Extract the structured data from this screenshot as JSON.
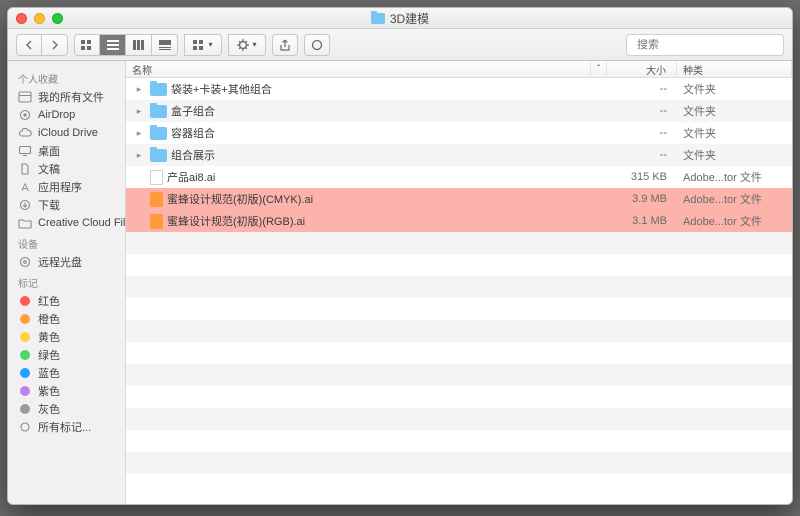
{
  "window": {
    "title": "3D建模"
  },
  "search": {
    "placeholder": "搜索"
  },
  "sidebar": {
    "sections": [
      {
        "header": "个人收藏",
        "items": [
          {
            "icon": "all-files",
            "label": "我的所有文件"
          },
          {
            "icon": "airdrop",
            "label": "AirDrop"
          },
          {
            "icon": "icloud",
            "label": "iCloud Drive"
          },
          {
            "icon": "desktop",
            "label": "桌面"
          },
          {
            "icon": "documents",
            "label": "文稿"
          },
          {
            "icon": "apps",
            "label": "应用程序"
          },
          {
            "icon": "downloads",
            "label": "下载"
          },
          {
            "icon": "folder",
            "label": "Creative Cloud Files"
          }
        ]
      },
      {
        "header": "设备",
        "items": [
          {
            "icon": "disc",
            "label": "远程光盘"
          }
        ]
      },
      {
        "header": "标记",
        "items": [
          {
            "color": "#ff5b56",
            "label": "红色"
          },
          {
            "color": "#ff9f3c",
            "label": "橙色"
          },
          {
            "color": "#ffd23c",
            "label": "黄色"
          },
          {
            "color": "#4cd964",
            "label": "绿色"
          },
          {
            "color": "#1ea1ff",
            "label": "蓝色"
          },
          {
            "color": "#c17fe8",
            "label": "紫色"
          },
          {
            "color": "#9b9b9b",
            "label": "灰色"
          },
          {
            "icon": "all-tags",
            "label": "所有标记..."
          }
        ]
      }
    ]
  },
  "columns": {
    "name": "名称",
    "size": "大小",
    "kind": "种类"
  },
  "rows": [
    {
      "type": "folder",
      "expandable": true,
      "name": "袋装+卡装+其他组合",
      "size": "--",
      "kind": "文件夹"
    },
    {
      "type": "folder",
      "expandable": true,
      "name": "盒子组合",
      "size": "--",
      "kind": "文件夹"
    },
    {
      "type": "folder",
      "expandable": true,
      "name": "容器组合",
      "size": "--",
      "kind": "文件夹"
    },
    {
      "type": "folder",
      "expandable": true,
      "name": "组合展示",
      "size": "--",
      "kind": "文件夹"
    },
    {
      "type": "file",
      "name": "产品ai8.ai",
      "size": "315 KB",
      "kind": "Adobe...tor 文件"
    },
    {
      "type": "ai",
      "name": "蜜蜂设计规范(初版)(CMYK).ai",
      "size": "3.9 MB",
      "kind": "Adobe...tor 文件",
      "highlight": true
    },
    {
      "type": "ai",
      "name": "蜜蜂设计规范(初版)(RGB).ai",
      "size": "3.1 MB",
      "kind": "Adobe...tor 文件",
      "highlight": true
    }
  ]
}
